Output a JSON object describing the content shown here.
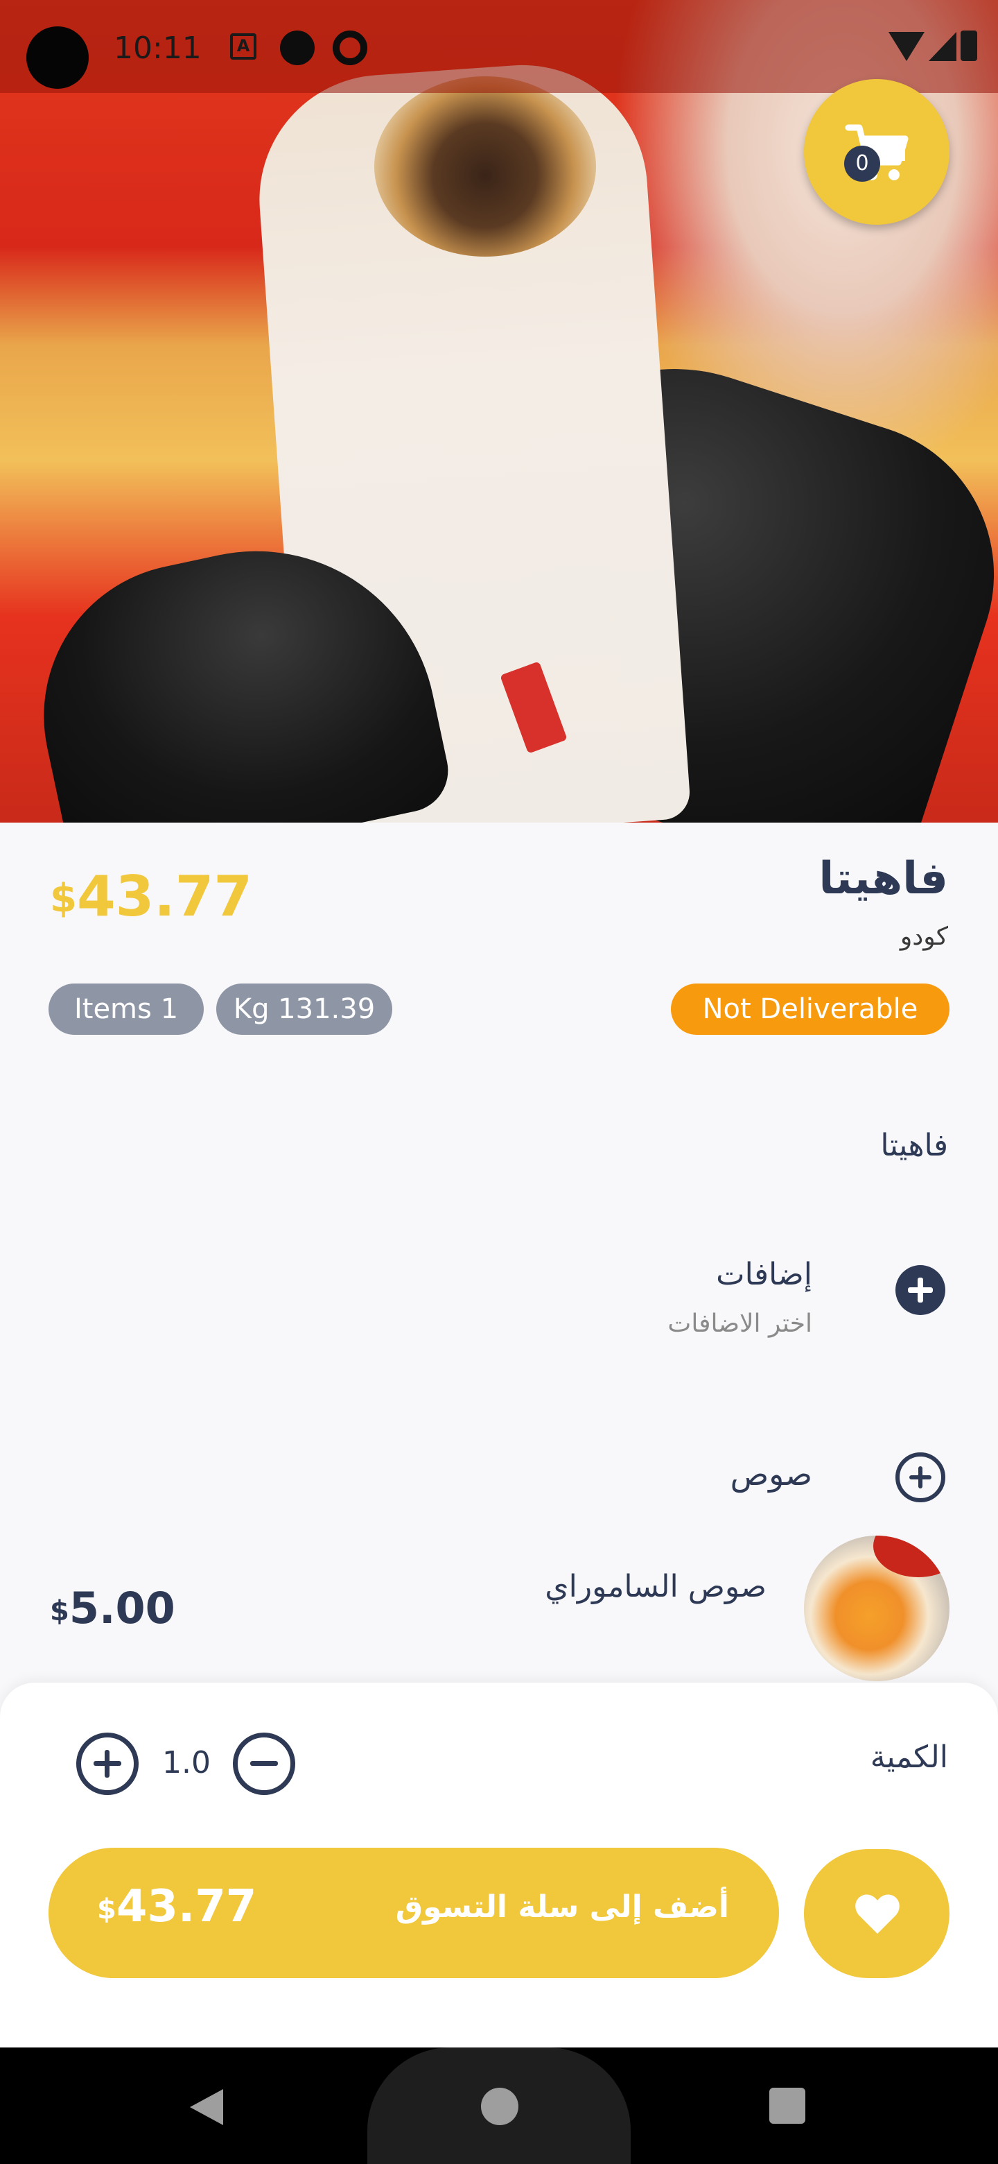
{
  "status_bar": {
    "time": "10:11",
    "icon_a": "A"
  },
  "cart": {
    "count": "0"
  },
  "product": {
    "title": "فاهيتا",
    "vendor": "كودو",
    "price_currency": "$",
    "price_value": "43.77",
    "description": "فاهيتا"
  },
  "badges": {
    "items": "Items 1",
    "weight": "Kg 131.39",
    "delivery": "Not Deliverable"
  },
  "addons": {
    "title": "إضافات",
    "subtitle": "اختر الاضافات"
  },
  "sauce": {
    "title": "صوص",
    "option_name": "صوص الساموراي",
    "option_price_currency": "$",
    "option_price_value": "5.00"
  },
  "quantity": {
    "label": "الكمية",
    "value": "1.0"
  },
  "add_to_cart": {
    "label": "أضف إلى سلة التسوق",
    "price_currency": "$",
    "price_value": "43.77"
  },
  "colors": {
    "accent": "#f1c73b",
    "primary": "#2e3a55",
    "warning": "#f79a0e",
    "badge_gray": "#8e96a6"
  }
}
